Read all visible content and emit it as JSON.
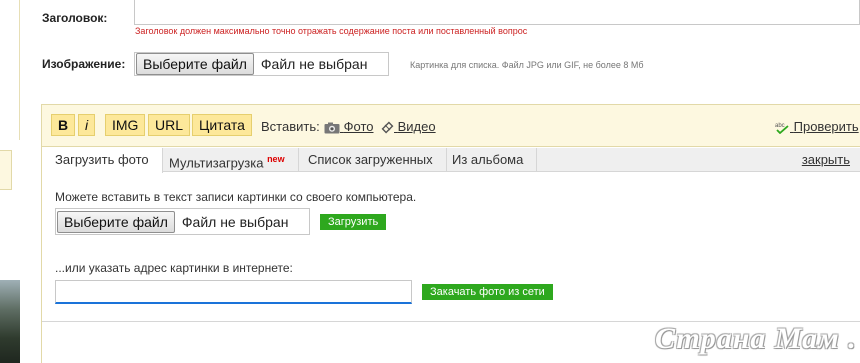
{
  "form": {
    "title_label": "Заголовок:",
    "title_value": "",
    "title_hint": "Заголовок должен максимально точно отражать содержание поста или поставленный вопрос",
    "image_label": "Изображение:",
    "image_file_button": "Выберите файл",
    "image_file_status": "Файл не выбран",
    "image_hint": "Картинка для списка. Файл JPG или GIF, не более 8 Мб"
  },
  "toolbar": {
    "bold": "B",
    "italic": "i",
    "img": "IMG",
    "url": "URL",
    "quote": "Цитата",
    "insert_label": "Вставить:",
    "photo_link": "Фото",
    "video_link": "Видео",
    "check_link": "Проверить"
  },
  "tabs": {
    "items": [
      {
        "label": "Загрузить фото",
        "active": true
      },
      {
        "label": "Мультизагрузка",
        "badge": "new"
      },
      {
        "label": "Список загруженных"
      },
      {
        "label": "Из альбома"
      }
    ],
    "close": "закрыть"
  },
  "upload": {
    "description": "Можете вставить в текст записи картинки со своего компьютера.",
    "file_button": "Выберите файл",
    "file_status": "Файл не выбран",
    "upload_button": "Загрузить",
    "url_description": "...или указать адрес картинки в интернете:",
    "url_value": "",
    "fetch_button": "Закачать фото из сети"
  },
  "watermark": "Страна Мам . ру",
  "colors": {
    "toolbar_bg": "#fdf8e0",
    "button_yellow": "#fde89a",
    "green": "#2ea81e",
    "hint_red": "#cc2222"
  }
}
